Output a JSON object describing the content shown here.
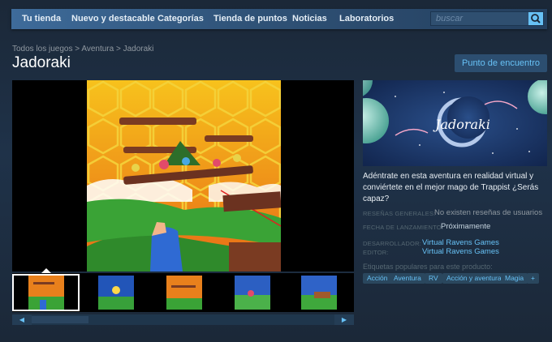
{
  "nav": {
    "items": [
      "Tu tienda",
      "Nuevo y destacable",
      "Categorías",
      "Tienda de puntos",
      "Noticias",
      "Laboratorios"
    ],
    "search_placeholder": "buscar"
  },
  "breadcrumb": {
    "items": [
      "Todos los juegos",
      "Aventura",
      "Jadoraki"
    ],
    "separator": ">"
  },
  "game": {
    "title": "Jadoraki",
    "community_button": "Punto de encuentro",
    "logo_text": "Jadoraki",
    "description": "Adéntrate en esta aventura en realidad virtual y conviértete en el mejor mago de Trappist ¿Serás capaz?",
    "reviews_label": "RESEÑAS GENERALES:",
    "reviews_value": "No existen reseñas de usuarios",
    "release_label": "FECHA DE LANZAMIENTO:",
    "release_value": "Próximamente",
    "developer_label": "DESARROLLADOR:",
    "developer_value": "Virtual Ravens Games",
    "publisher_label": "EDITOR:",
    "publisher_value": "Virtual Ravens Games",
    "tags_label": "Etiquetas populares para este producto:",
    "tags": [
      "Acción",
      "Aventura",
      "RV",
      "Acción y aventura",
      "Magia",
      "+"
    ]
  },
  "media": {
    "thumbnail_count": 5,
    "selected_thumbnail": 1
  },
  "colors": {
    "accent": "#67c1f5",
    "background": "#1b2838",
    "nav": "#3e6b9a"
  }
}
